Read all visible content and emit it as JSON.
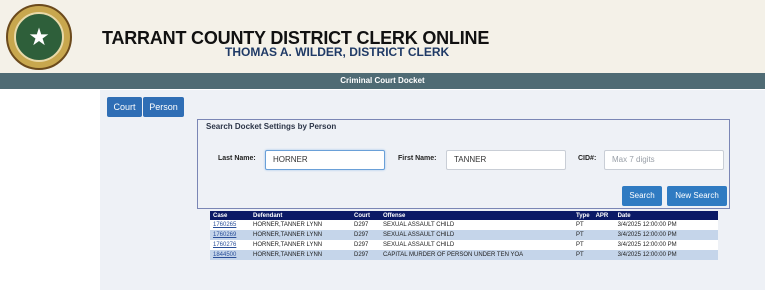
{
  "header": {
    "title": "TARRANT COUNTY DISTRICT CLERK ONLINE",
    "subtitle": "THOMAS A. WILDER, DISTRICT CLERK",
    "seal_icon": "county-seal"
  },
  "topbar": {
    "label": "Criminal Court Docket"
  },
  "tabs": [
    {
      "label": "Court"
    },
    {
      "label": "Person"
    }
  ],
  "search": {
    "heading": "Search Docket Settings by Person",
    "last_name_label": "Last Name:",
    "last_name_value": "HORNER",
    "first_name_label": "First Name:",
    "first_name_value": "TANNER",
    "cid_label": "CID#:",
    "cid_placeholder": "Max 7 digits",
    "search_button": "Search",
    "new_search_button": "New Search"
  },
  "results": {
    "columns": [
      "Case",
      "Defendant",
      "Court",
      "Offense",
      "Type",
      "APR",
      "Date"
    ],
    "rows": [
      {
        "case": "1760265",
        "defendant": "HORNER,TANNER LYNN",
        "court": "D297",
        "offense": "SEXUAL ASSAULT CHILD",
        "type": "PT",
        "apr": "",
        "date": "3/4/2025 12:00:00 PM"
      },
      {
        "case": "1760269",
        "defendant": "HORNER,TANNER LYNN",
        "court": "D297",
        "offense": "SEXUAL ASSAULT CHILD",
        "type": "PT",
        "apr": "",
        "date": "3/4/2025 12:00:00 PM"
      },
      {
        "case": "1760276",
        "defendant": "HORNER,TANNER LYNN",
        "court": "D297",
        "offense": "SEXUAL ASSAULT CHILD",
        "type": "PT",
        "apr": "",
        "date": "3/4/2025 12:00:00 PM"
      },
      {
        "case": "1844500",
        "defendant": "HORNER,TANNER LYNN",
        "court": "D297",
        "offense": "CAPITAL MURDER OF PERSON UNDER TEN YOA",
        "type": "PT",
        "apr": "",
        "date": "3/4/2025 12:00:00 PM"
      }
    ]
  },
  "colors": {
    "header_bg": "#f4f1e8",
    "topbar": "#4f6b74",
    "table_header": "#0b1a66",
    "row_alt": "#c5d5ea",
    "button": "#2f7bc2"
  }
}
